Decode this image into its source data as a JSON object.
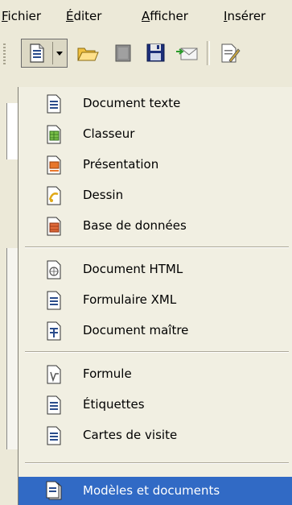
{
  "menubar": {
    "items": [
      {
        "label": "Fichier",
        "mnemonic": "F"
      },
      {
        "label": "Éditer",
        "mnemonic": "É"
      },
      {
        "label": "Afficher",
        "mnemonic": "A"
      },
      {
        "label": "Insérer",
        "mnemonic": "I"
      }
    ]
  },
  "colors": {
    "menu_bg": "#f1efe2",
    "highlight": "#316ac5",
    "chrome": "#ece9d8"
  },
  "menu": {
    "items": [
      {
        "label": "Document texte",
        "icon": "text-document-icon"
      },
      {
        "label": "Classeur",
        "icon": "spreadsheet-icon"
      },
      {
        "label": "Présentation",
        "icon": "presentation-icon"
      },
      {
        "label": "Dessin",
        "icon": "drawing-icon"
      },
      {
        "label": "Base de données",
        "icon": "database-icon"
      },
      {
        "label": "Document HTML",
        "icon": "html-document-icon"
      },
      {
        "label": "Formulaire XML",
        "icon": "xml-form-icon"
      },
      {
        "label": "Document maître",
        "icon": "master-document-icon"
      },
      {
        "label": "Formule",
        "icon": "formula-icon"
      },
      {
        "label": "Étiquettes",
        "icon": "labels-icon"
      },
      {
        "label": "Cartes de visite",
        "icon": "business-cards-icon"
      },
      {
        "label": "Modèles et documents",
        "icon": "templates-icon"
      }
    ]
  }
}
